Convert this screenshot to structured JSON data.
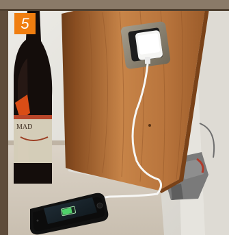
{
  "badge": {
    "number": "5",
    "color": "#f07e10"
  },
  "wine_label": {
    "text": "MAD"
  },
  "phone_screen": {
    "accent": "#4fd06a"
  }
}
